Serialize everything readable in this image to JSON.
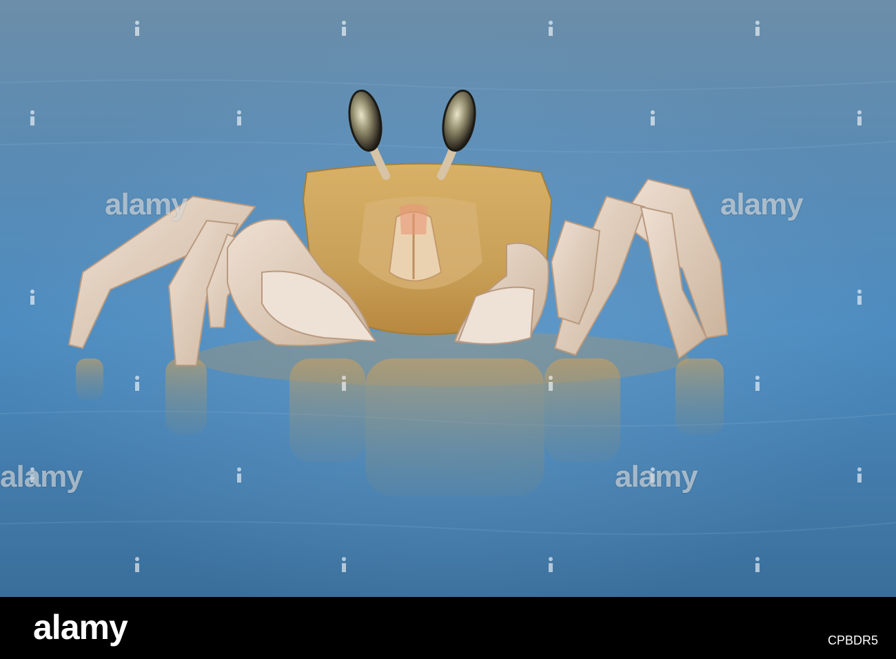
{
  "photo": {
    "subject_icon": "crab-photo",
    "colors": {
      "water_top": "#5c7f9f",
      "water_mid": "#4b86b4",
      "water_bottom": "#3f6f98",
      "sand": "#c9a261",
      "shell": "#c8a050",
      "leg": "#e6d3bf",
      "eye": "#2c2a24"
    }
  },
  "watermark": {
    "text": "alamy"
  },
  "footer": {
    "logo": "alamy",
    "image_id": "CPBDR5"
  }
}
